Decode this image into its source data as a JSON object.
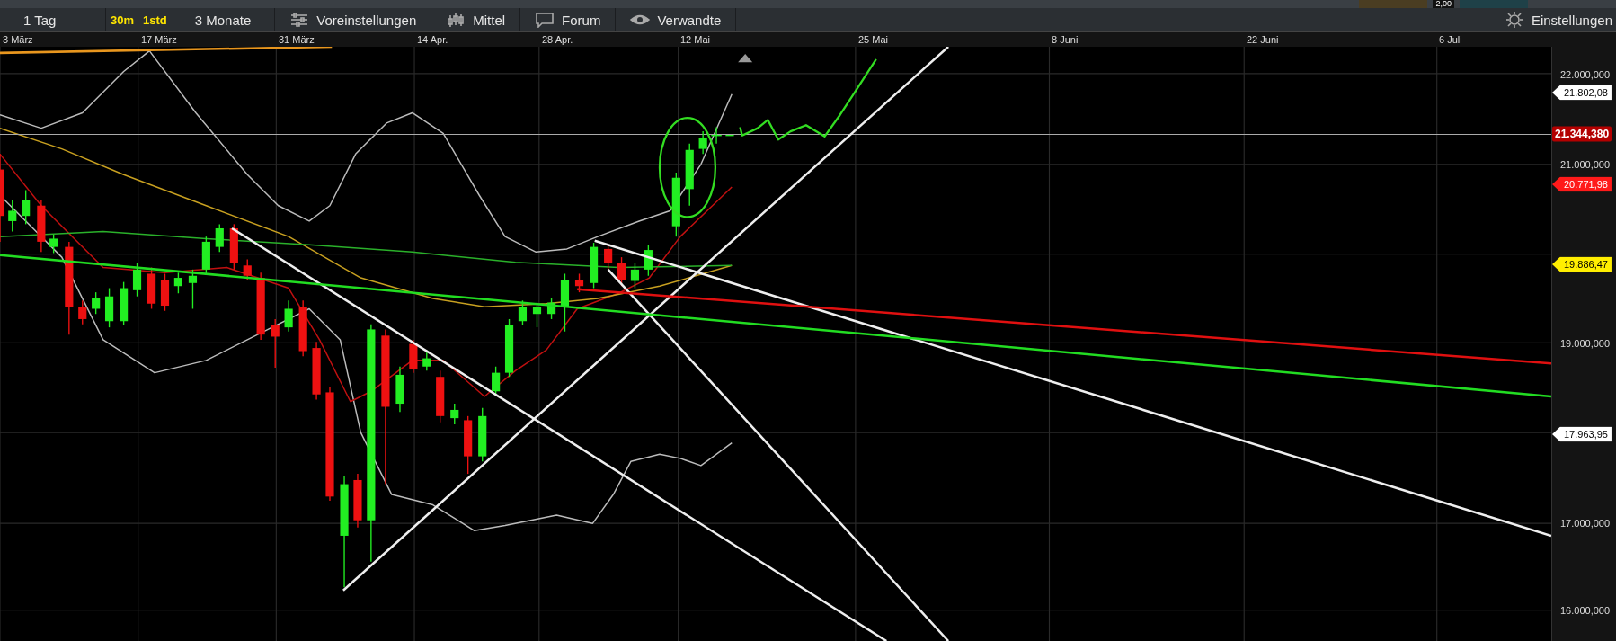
{
  "top_strip": {
    "value": "2,00"
  },
  "toolbar": {
    "items": [
      {
        "kind": "period",
        "label": "1 Tag"
      },
      {
        "kind": "interval",
        "label": "30m"
      },
      {
        "kind": "interval",
        "label": "1std"
      },
      {
        "kind": "period",
        "label": "3 Monate"
      },
      {
        "kind": "menu",
        "label": "Voreinstellungen"
      },
      {
        "kind": "menu",
        "label": "Mittel"
      },
      {
        "kind": "menu",
        "label": "Forum"
      },
      {
        "kind": "menu",
        "label": "Verwandte"
      }
    ],
    "settings": "Einstellungen"
  },
  "chart": {
    "date_labels": [
      "3 März",
      "17 März",
      "31 März",
      "14 Apr.",
      "28 Apr.",
      "12 Mai",
      "25 Mai",
      "8 Juni",
      "22 Juni",
      "6 Juli"
    ],
    "price_labels": [
      "22.000,000",
      "21.000,000",
      "19.000,000",
      "17.000,000",
      "16.000,000"
    ],
    "price_tags": [
      {
        "kind": "marker",
        "text": "21.802,08",
        "color": "#ffffff"
      },
      {
        "kind": "last",
        "text": "21.344,380",
        "color": "#b30000"
      },
      {
        "kind": "marker",
        "text": "20.771,98",
        "color": "#ff1a1a"
      },
      {
        "kind": "marker",
        "text": "19.886,47",
        "color": "#ffee00"
      },
      {
        "kind": "marker",
        "text": "17.963,95",
        "color": "#ffffff"
      }
    ]
  }
}
